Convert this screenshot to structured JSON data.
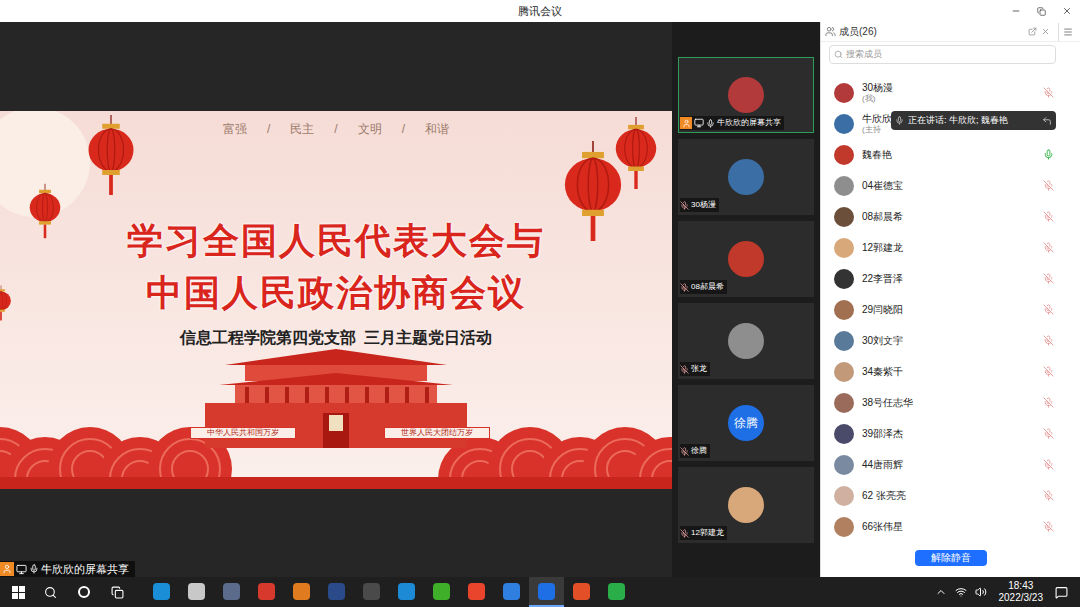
{
  "window": {
    "title": "腾讯会议"
  },
  "share_label": "牛欣欣的屏幕共享",
  "slide": {
    "values": [
      "富强",
      "民主",
      "文明",
      "和谐"
    ],
    "separator": "/",
    "title_lines": [
      "学习全国人民代表大会与",
      "中国人民政治协商会议"
    ],
    "subtitle": "信息工程学院第四党支部  三月主题党日活动",
    "banners": [
      "中华人民共和国万岁",
      "世界人民大团结万岁"
    ]
  },
  "video_tiles": [
    {
      "name": "牛欣欣的屏幕共享",
      "kind": "sharing",
      "selected": true,
      "muted": false
    },
    {
      "name": "30杨漫",
      "kind": "avatar",
      "selected": false,
      "muted": true
    },
    {
      "name": "08郝晨希",
      "kind": "avatar",
      "selected": false,
      "muted": true
    },
    {
      "name": "张龙",
      "kind": "avatar",
      "selected": false,
      "muted": true
    },
    {
      "name": "徐腾",
      "kind": "initials",
      "selected": false,
      "muted": true
    },
    {
      "name": "12郭建龙",
      "kind": "avatar",
      "selected": false,
      "muted": true
    }
  ],
  "members": {
    "title": "成员(26)",
    "search_placeholder": "搜索成员",
    "items": [
      {
        "name": "30杨漫",
        "note": "(我)",
        "muted": true
      },
      {
        "name": "牛欣欣",
        "note": "(主持",
        "muted": true
      },
      {
        "name": "魏春艳",
        "note": "",
        "muted": false
      },
      {
        "name": "04崔德宝",
        "note": "",
        "muted": true
      },
      {
        "name": "08郝晨希",
        "note": "",
        "muted": true
      },
      {
        "name": "12郭建龙",
        "note": "",
        "muted": true
      },
      {
        "name": "22李晋泽",
        "note": "",
        "muted": true
      },
      {
        "name": "29闫晓阳",
        "note": "",
        "muted": true
      },
      {
        "name": "30刘文宇",
        "note": "",
        "muted": true
      },
      {
        "name": "34秦紫千",
        "note": "",
        "muted": true
      },
      {
        "name": "38号任志华",
        "note": "",
        "muted": true
      },
      {
        "name": "39邵泽杰",
        "note": "",
        "muted": true
      },
      {
        "name": "44唐雨辉",
        "note": "",
        "muted": true
      },
      {
        "name": "62 张亮亮",
        "note": "",
        "muted": true
      },
      {
        "name": "66张伟星",
        "note": "",
        "muted": true
      }
    ],
    "speaking_tooltip": "正在讲话: 牛欣欣; 魏春艳",
    "unmute_button": "解除静音"
  },
  "taskbar": {
    "time": "18:43",
    "date": "2022/3/23",
    "apps": [
      {
        "color": "#1a8fd8",
        "selected": false
      },
      {
        "color": "#c8c8c8",
        "selected": false
      },
      {
        "color": "#5a6b8c",
        "selected": false
      },
      {
        "color": "#d73a2c",
        "selected": false
      },
      {
        "color": "#e07b20",
        "selected": false
      },
      {
        "color": "#2a4a8a",
        "selected": false
      },
      {
        "color": "#4a4a4a",
        "selected": false
      },
      {
        "color": "#1d8ad6",
        "selected": false
      },
      {
        "color": "#3fae29",
        "selected": false
      },
      {
        "color": "#e8452c",
        "selected": false
      },
      {
        "color": "#2f7fe0",
        "selected": false
      },
      {
        "color": "#1e6fe6",
        "selected": true
      },
      {
        "color": "#e34f26",
        "selected": false
      },
      {
        "color": "#2aae4a",
        "selected": false
      }
    ]
  }
}
